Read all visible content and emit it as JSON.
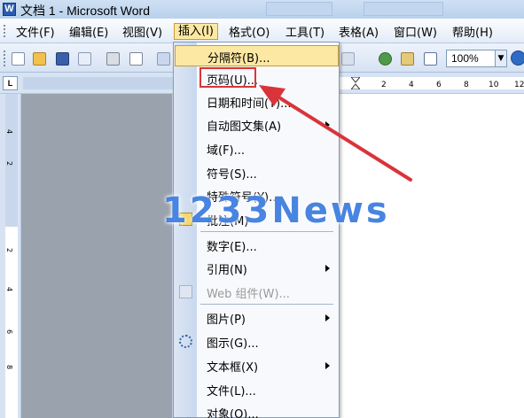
{
  "window": {
    "title": "文档 1 - Microsoft Word"
  },
  "menubar": {
    "items": [
      {
        "label": "文件(F)"
      },
      {
        "label": "编辑(E)"
      },
      {
        "label": "视图(V)"
      },
      {
        "label": "插入(I)"
      },
      {
        "label": "格式(O)"
      },
      {
        "label": "工具(T)"
      },
      {
        "label": "表格(A)"
      },
      {
        "label": "窗口(W)"
      },
      {
        "label": "帮助(H)"
      }
    ],
    "active": "插入(I)"
  },
  "toolbar": {
    "zoom": "100%"
  },
  "ruler": {
    "ticks": [
      "2",
      "2",
      "4",
      "6",
      "8",
      "10",
      "12"
    ]
  },
  "vertical_ruler": {
    "ticks": [
      "4",
      "2",
      "2",
      "4",
      "6",
      "8"
    ]
  },
  "insert_menu": {
    "items": [
      {
        "label": "分隔符(B)...",
        "submenu": false,
        "enabled": true
      },
      {
        "label": "页码(U)...",
        "submenu": false,
        "enabled": true,
        "highlighted": true
      },
      {
        "label": "日期和时间(T)...",
        "submenu": false,
        "enabled": true
      },
      {
        "label": "自动图文集(A)",
        "submenu": true,
        "enabled": true
      },
      {
        "label": "域(F)...",
        "submenu": false,
        "enabled": true
      },
      {
        "label": "符号(S)...",
        "submenu": false,
        "enabled": true
      },
      {
        "label": "特殊符号(Y)...",
        "submenu": false,
        "enabled": true
      },
      {
        "label": "批注(M)",
        "submenu": false,
        "enabled": true
      },
      {
        "label": "数字(E)...",
        "submenu": false,
        "enabled": true
      },
      {
        "label": "引用(N)",
        "submenu": true,
        "enabled": true
      },
      {
        "label": "Web 组件(W)...",
        "submenu": false,
        "enabled": false
      },
      {
        "label": "图片(P)",
        "submenu": true,
        "enabled": true
      },
      {
        "label": "图示(G)...",
        "submenu": false,
        "enabled": true
      },
      {
        "label": "文本框(X)",
        "submenu": true,
        "enabled": true
      },
      {
        "label": "文件(L)...",
        "submenu": false,
        "enabled": true
      },
      {
        "label": "对象(O)...",
        "submenu": false,
        "enabled": true
      }
    ]
  },
  "watermark": {
    "text": "1233News"
  },
  "colors": {
    "menu_highlight": "#fde8a3",
    "annotation_red": "#d9343a",
    "watermark_blue": "#2a6edc"
  }
}
